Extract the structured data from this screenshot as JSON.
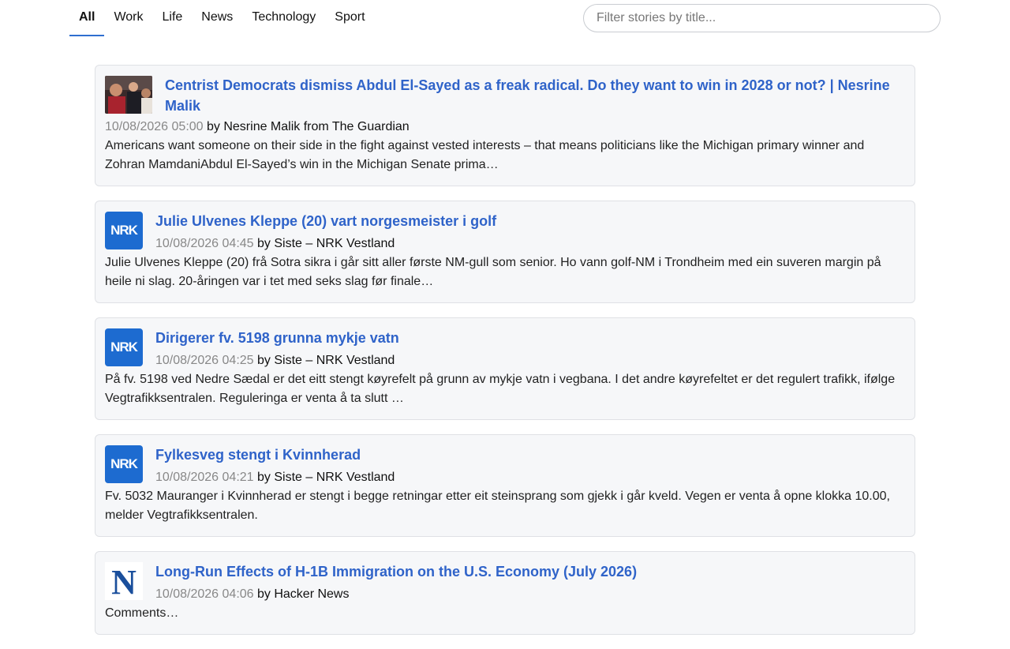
{
  "nav": {
    "tabs": [
      {
        "label": "All"
      },
      {
        "label": "Work"
      },
      {
        "label": "Life"
      },
      {
        "label": "News"
      },
      {
        "label": "Technology"
      },
      {
        "label": "Sport"
      }
    ],
    "active_tab": "All"
  },
  "filter": {
    "placeholder": "Filter stories by title...",
    "value": ""
  },
  "stories": [
    {
      "title": "Centrist Democrats dismiss Abdul El-Sayed as a freak radical. Do they want to win in 2028 or not? | Nesrine Malik",
      "date": "10/08/2026 05:00",
      "byline": " by Nesrine Malik from The Guardian",
      "summary": "Americans want someone on their side in the fight against vested interests – that means politicians like the Michigan primary winner and Zohran MamdaniAbdul El-Sayed’s win in the Michigan Senate prima…",
      "icon": "photo-thumbnail"
    },
    {
      "title": "Julie Ulvenes Kleppe (20) vart norgesmeister i golf",
      "date": "10/08/2026 04:45",
      "byline": " by Siste – NRK Vestland",
      "summary": "Julie Ulvenes Kleppe (20) frå Sotra sikra i går sitt aller første NM-gull som senior. Ho vann golf-NM i Trondheim med ein suveren margin på heile ni slag. 20-åringen var i tet med seks slag før finale…",
      "icon": "nrk-logo",
      "logo_text": "NRK"
    },
    {
      "title": "Dirigerer fv. 5198 grunna mykje vatn",
      "date": "10/08/2026 04:25",
      "byline": " by Siste – NRK Vestland",
      "summary": "På fv. 5198 ved Nedre Sædal er det eitt stengt køyrefelt på grunn av mykje vatn i vegbana. I det andre køyrefeltet er det regulert trafikk, ifølge Vegtrafikksentralen. Reguleringa er venta å ta slutt …",
      "icon": "nrk-logo",
      "logo_text": "NRK"
    },
    {
      "title": "Fylkesveg stengt i Kvinnherad",
      "date": "10/08/2026 04:21",
      "byline": " by Siste – NRK Vestland",
      "summary": "Fv. 5032 Mauranger i Kvinnherad er stengt i begge retningar etter eit steinsprang som gjekk i går kveld. Vegen er venta å opne klokka 10.00, melder Vegtrafikksentralen.",
      "icon": "nrk-logo",
      "logo_text": "NRK"
    },
    {
      "title": "Long-Run Effects of H-1B Immigration on the U.S. Economy (July 2026)",
      "date": "10/08/2026 04:06",
      "byline": " by Hacker News",
      "summary": "Comments…",
      "icon": "hn-logo",
      "logo_text": "N"
    }
  ],
  "colors": {
    "accent": "#2f63c9",
    "nrk_blue": "#1d6bd0",
    "card_bg": "#f6f7f9"
  }
}
